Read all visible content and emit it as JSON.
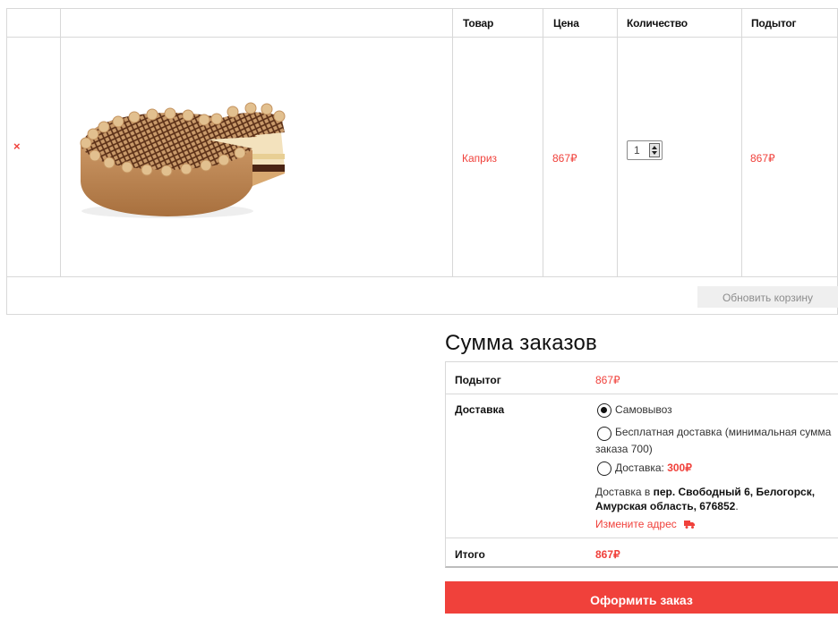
{
  "cart": {
    "headers": {
      "product": "Товар",
      "price": "Цена",
      "quantity": "Количество",
      "subtotal": "Подытог"
    },
    "item": {
      "remove": "×",
      "image": "cake",
      "name": "Каприз",
      "price": "867₽",
      "quantity": "1",
      "subtotal": "867₽"
    },
    "update_button": "Обновить корзину"
  },
  "totals": {
    "title": "Сумма заказов",
    "subtotal_label": "Подытог",
    "subtotal_value": "867₽",
    "shipping_label": "Доставка",
    "shipping_options": [
      {
        "label": "Самовывоз",
        "selected": true
      },
      {
        "label_line1": "Бесплатная доставка (минимальная сумма",
        "label_line2": "заказа 700)",
        "selected": false
      },
      {
        "label": "Доставка: ",
        "price": "300₽",
        "selected": false
      }
    ],
    "address_prefix": "Доставка в ",
    "address_bold": "пер. Свободный 6, Белогорск, Амурская область, 676852",
    "address_suffix": ".",
    "change_address": "Измените адрес",
    "change_address_icon": "truck-icon",
    "total_label": "Итого",
    "total_value": "867₽"
  },
  "checkout_button": "Оформить заказ",
  "colors": {
    "accent": "#f0413b",
    "border": "#d8d8d8",
    "update_button_bg": "#efefef"
  }
}
